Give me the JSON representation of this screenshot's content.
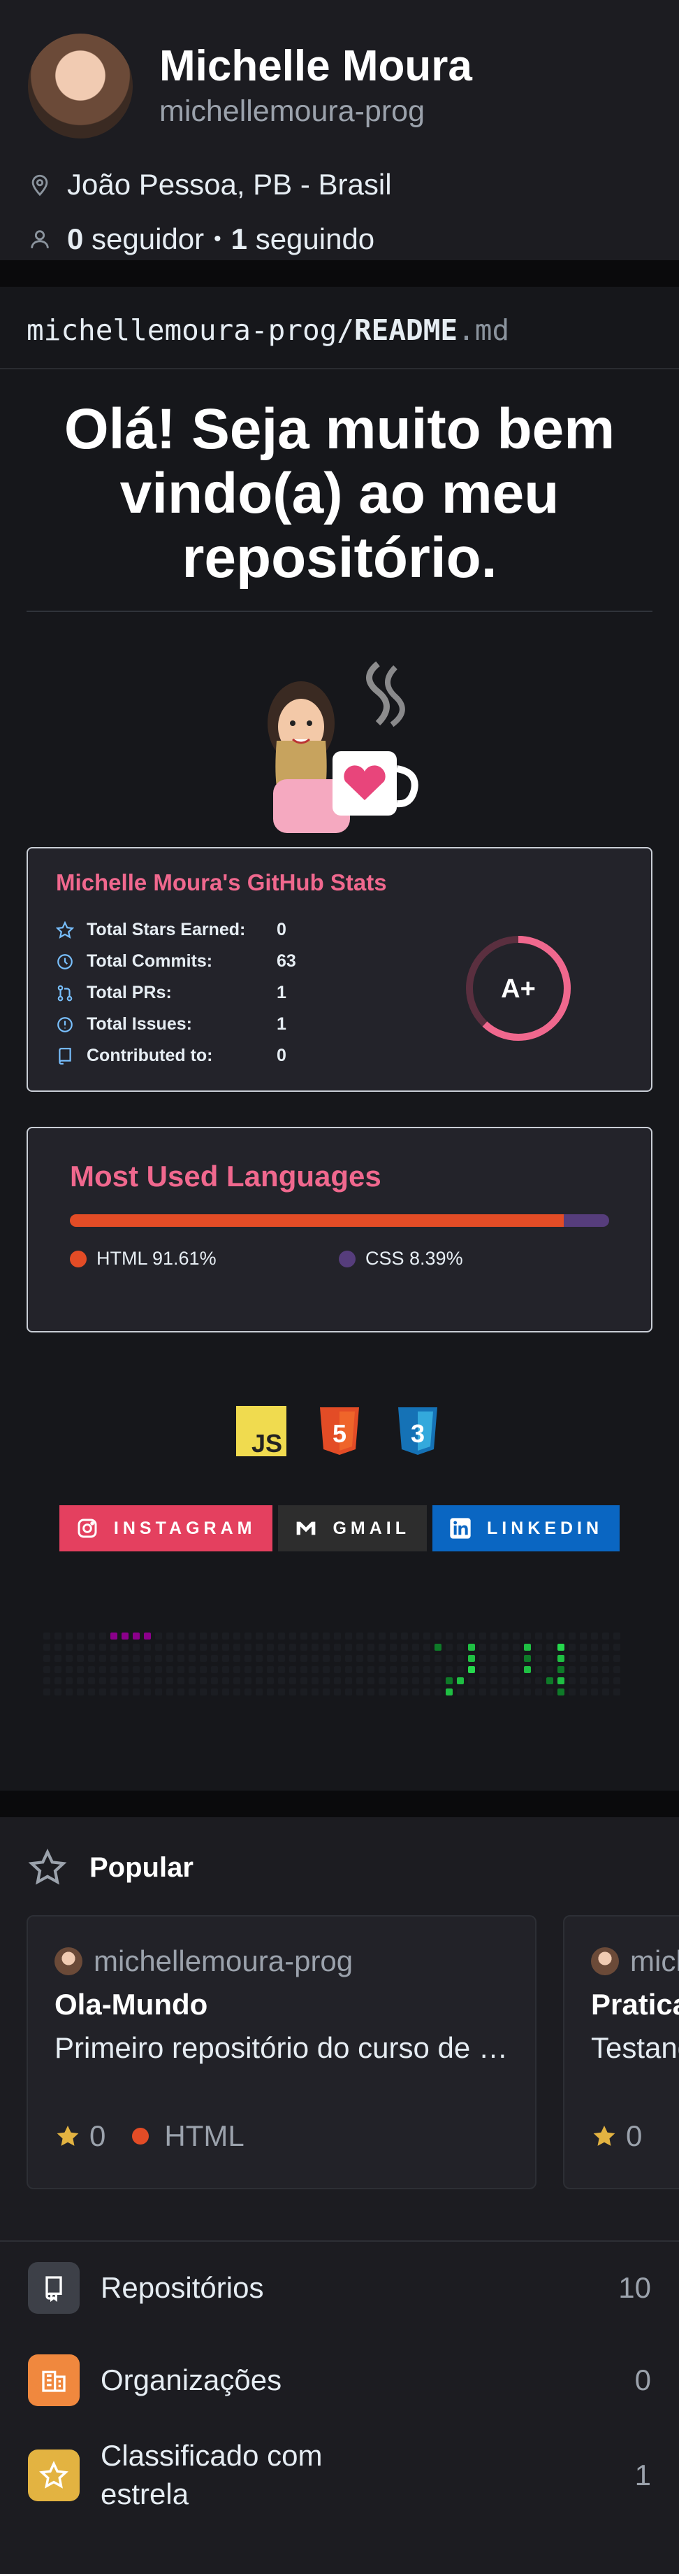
{
  "profile": {
    "name": "Michelle Moura",
    "login": "michellemoura-prog",
    "location": "João Pessoa, PB - Brasil",
    "followers_count": "0",
    "followers_label": "seguidor",
    "following_count": "1",
    "following_label": "seguindo"
  },
  "readme": {
    "path_prefix": "michellemoura-prog/",
    "path_name": "README",
    "path_ext": ".md",
    "heading": "Olá! Seja muito bem vindo(a) ao meu repositório.",
    "stats_card": {
      "title": "Michelle Moura's GitHub Stats",
      "rows": [
        {
          "label": "Total Stars Earned:",
          "value": "0",
          "icon": "star-icon"
        },
        {
          "label": "Total Commits:",
          "value": "63",
          "icon": "history-icon"
        },
        {
          "label": "Total PRs:",
          "value": "1",
          "icon": "pull-request-icon"
        },
        {
          "label": "Total Issues:",
          "value": "1",
          "icon": "issue-icon"
        },
        {
          "label": "Contributed to:",
          "value": "0",
          "icon": "repo-icon"
        }
      ],
      "rank": "A+",
      "rank_progress": 0.62
    },
    "langs_card": {
      "title": "Most Used Languages",
      "languages": [
        {
          "name": "HTML",
          "percent": 91.61,
          "label": "HTML 91.61%",
          "color": "#e34c26"
        },
        {
          "name": "CSS",
          "percent": 8.39,
          "label": "CSS 8.39%",
          "color": "#563d7c"
        }
      ]
    },
    "tech_icons": [
      "javascript-icon",
      "html5-icon",
      "css3-icon"
    ],
    "socials": [
      {
        "label": "INSTAGRAM",
        "color": "#e4405f",
        "icon": "instagram-icon"
      },
      {
        "label": "GMAIL",
        "color": "#2d2d2d",
        "icon": "gmail-icon"
      },
      {
        "label": "LINKEDIN",
        "color": "#0a66c2",
        "icon": "linkedin-icon"
      }
    ]
  },
  "popular": {
    "title": "Popular",
    "repos": [
      {
        "owner": "michellemoura-prog",
        "name": "Ola-Mundo",
        "description": "Primeiro repositório do curso de HTML e CSS",
        "stars": "0",
        "language": "HTML"
      },
      {
        "owner": "michellemoura-prog",
        "name": "Praticando",
        "description": "Testando",
        "stars": "0",
        "language": ""
      }
    ]
  },
  "menu": [
    {
      "label": "Repositórios",
      "count": "10",
      "color": "#3d4048",
      "icon": "repo-icon"
    },
    {
      "label": "Organizações",
      "count": "0",
      "color": "#f0883e",
      "icon": "organization-icon"
    },
    {
      "label": "Classificado com estrela",
      "count": "1",
      "color": "#e3b341",
      "icon": "star-icon"
    }
  ]
}
